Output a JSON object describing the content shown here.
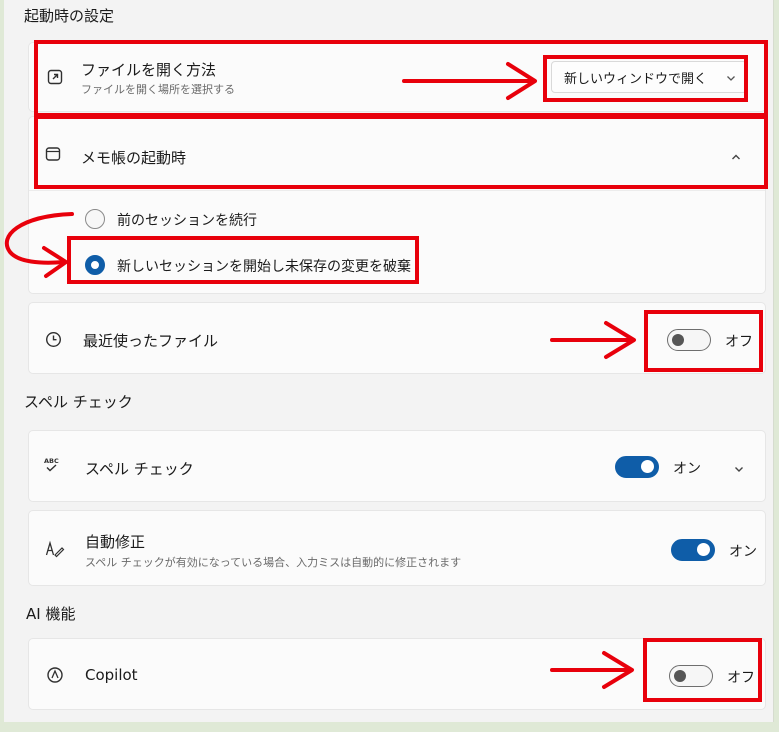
{
  "sections": {
    "startup": "起動時の設定",
    "spellcheck": "スペル チェック",
    "ai": "AI 機能"
  },
  "open_file": {
    "title": "ファイルを開く方法",
    "subtitle": "ファイルを開く場所を選択する",
    "selected": "新しいウィンドウで開く",
    "icon": "open-in-new-icon"
  },
  "notepad_startup": {
    "title": "メモ帳の起動時",
    "icon": "notepad-window-icon",
    "options": [
      {
        "label": "前のセッションを続行",
        "selected": false
      },
      {
        "label": "新しいセッションを開始し未保存の変更を破棄",
        "selected": true
      }
    ]
  },
  "recent_files": {
    "title": "最近使ったファイル",
    "state": "オフ",
    "on": false,
    "icon": "clock-icon"
  },
  "spell_check": {
    "title": "スペル チェック",
    "state": "オン",
    "on": true,
    "icon": "abc-check-icon"
  },
  "autocorrect": {
    "title": "自動修正",
    "subtitle": "スペル チェックが有効になっている場合、入力ミスは自動的に修正されます",
    "state": "オン",
    "on": true,
    "icon": "pen-autocorrect-icon"
  },
  "copilot": {
    "title": "Copilot",
    "state": "オフ",
    "on": false,
    "icon": "copilot-icon"
  },
  "colors": {
    "accent": "#0f5da8",
    "annotation": "#e8000b"
  }
}
